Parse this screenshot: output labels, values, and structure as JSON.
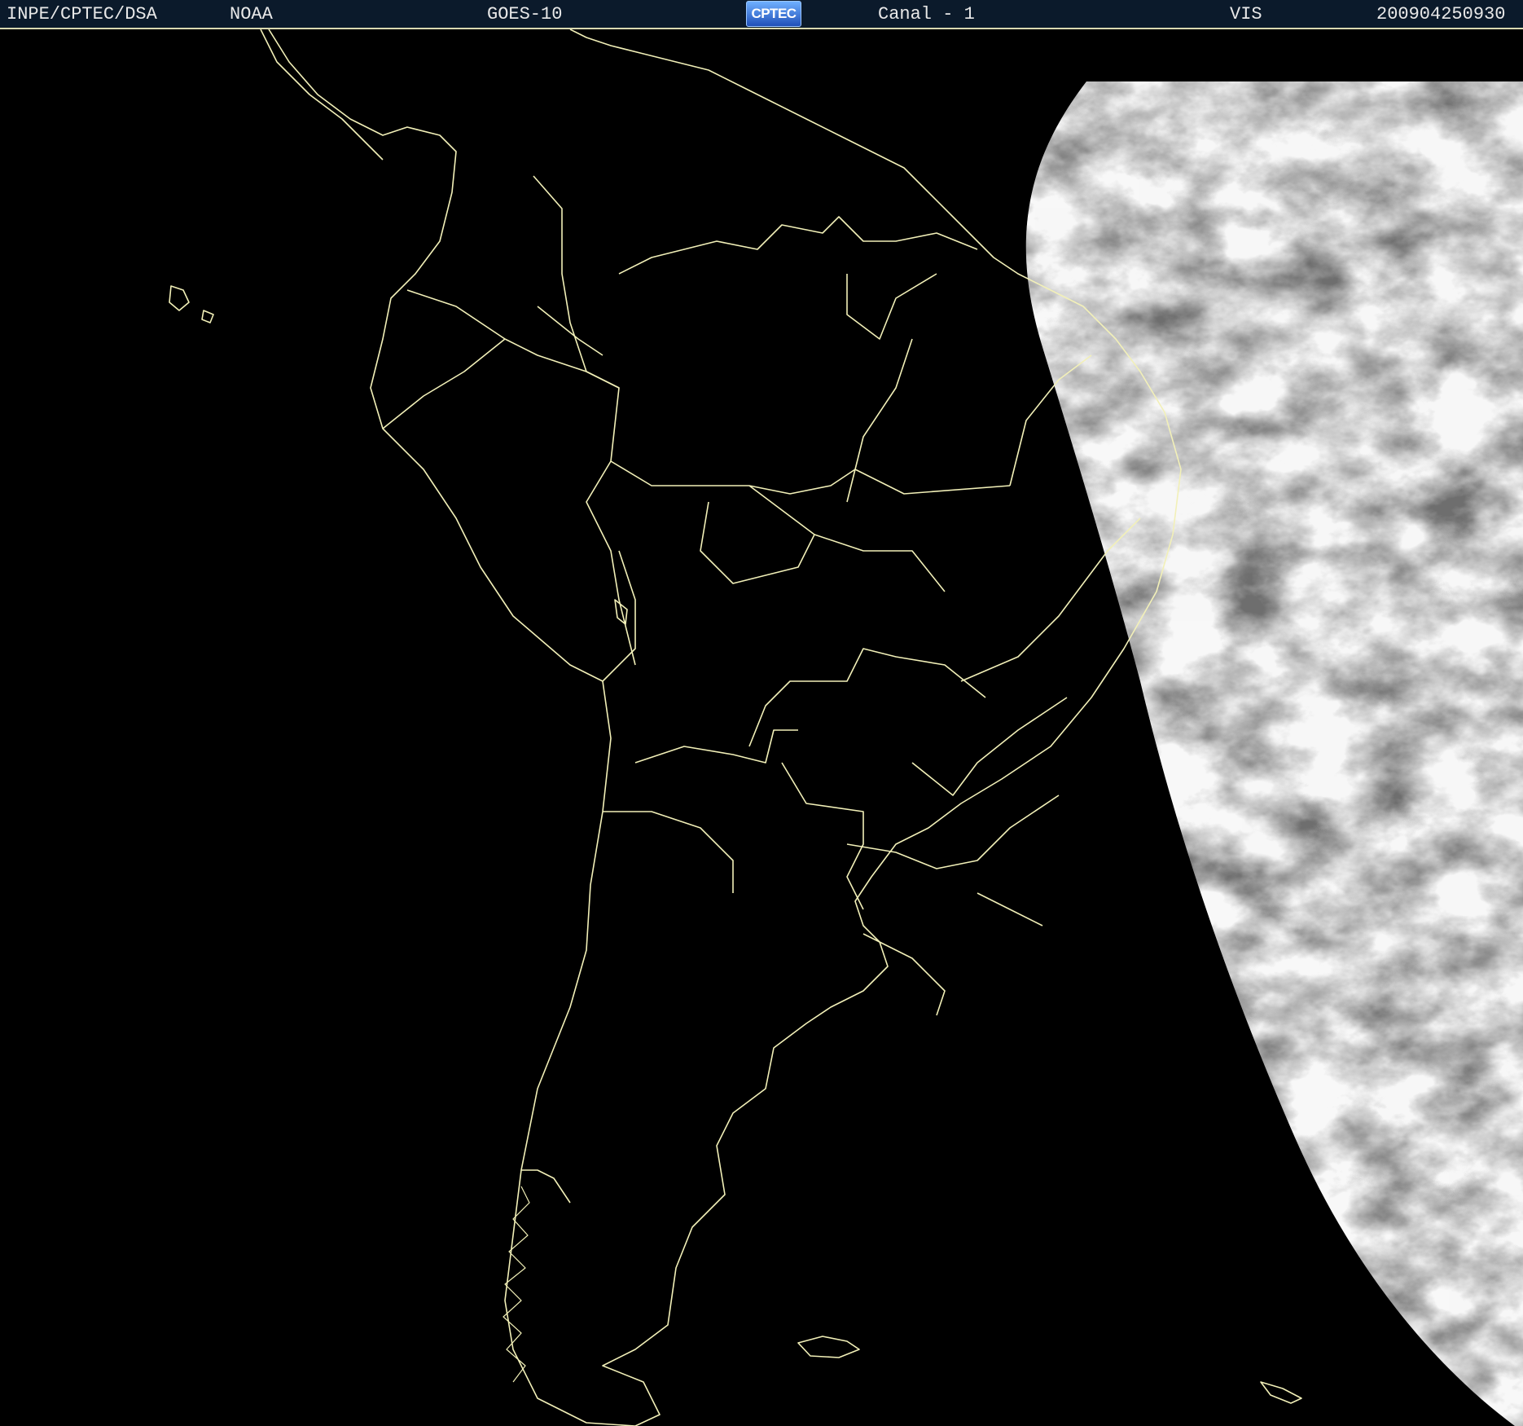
{
  "header": {
    "org": "INPE/CPTEC/DSA",
    "agency": "NOAA",
    "satellite": "GOES-10",
    "logo_text": "CPTEC",
    "channel": "Canal - 1",
    "band": "VIS",
    "timestamp": "200904250930"
  },
  "colors": {
    "header_bg": "#0b1a2b",
    "border_line": "#f2f0b8",
    "space": "#000000"
  },
  "icons": {
    "logo": "cptec-logo-icon"
  }
}
